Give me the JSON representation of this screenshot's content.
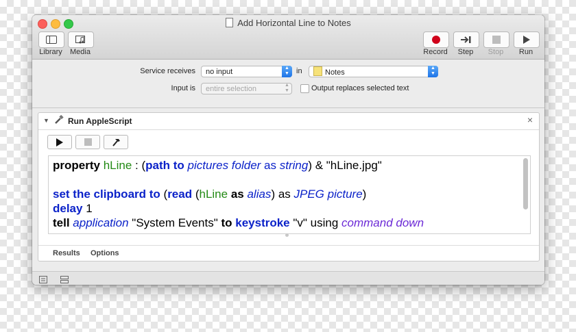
{
  "window": {
    "title": "Add Horizontal Line to Notes"
  },
  "toolbar": {
    "library_label": "Library",
    "media_label": "Media",
    "record_label": "Record",
    "step_label": "Step",
    "stop_label": "Stop",
    "run_label": "Run"
  },
  "service": {
    "receives_label": "Service receives",
    "receives_value": "no input",
    "in_label": "in",
    "in_value": "Notes",
    "input_is_label": "Input is",
    "input_is_value": "entire selection",
    "output_replaces_label": "Output replaces selected text",
    "output_replaces_checked": false
  },
  "action": {
    "title": "Run AppleScript",
    "close_glyph": "×",
    "code_lines": [
      "property hLine : (path to pictures folder as string) & \"hLine.jpg\"",
      "",
      "set the clipboard to (read (hLine as alias) as JPEG picture)",
      "delay 1",
      "tell application \"System Events\" to keystroke \"v\" using command down"
    ],
    "code_tokens": {
      "l1": [
        "property",
        "hLine",
        " : (",
        "path to",
        "pictures folder",
        " as ",
        "string",
        ") & \"hLine.jpg\""
      ],
      "l3": [
        "set the clipboard to",
        " (",
        "read",
        " (",
        "hLine",
        " as ",
        "alias",
        ") as ",
        "JPEG picture",
        ")"
      ],
      "l4": [
        "delay",
        " 1"
      ],
      "l5": [
        "tell",
        "application",
        " \"System Events\" ",
        "to",
        "keystroke",
        " \"v\" using ",
        "command down"
      ]
    },
    "footer_tabs": [
      "Results",
      "Options"
    ]
  },
  "colors": {
    "keyword_blue": "#0b22c9",
    "variable_green": "#238a15",
    "enum_purple": "#6c2ad6",
    "record_red": "#d0021b"
  },
  "icons": [
    "library-icon",
    "media-icon",
    "record-icon",
    "step-icon",
    "stop-icon",
    "run-icon",
    "play-icon",
    "stop-square-icon",
    "compile-hammer-icon",
    "applescript-icon",
    "list-view-icon",
    "flow-view-icon"
  ]
}
